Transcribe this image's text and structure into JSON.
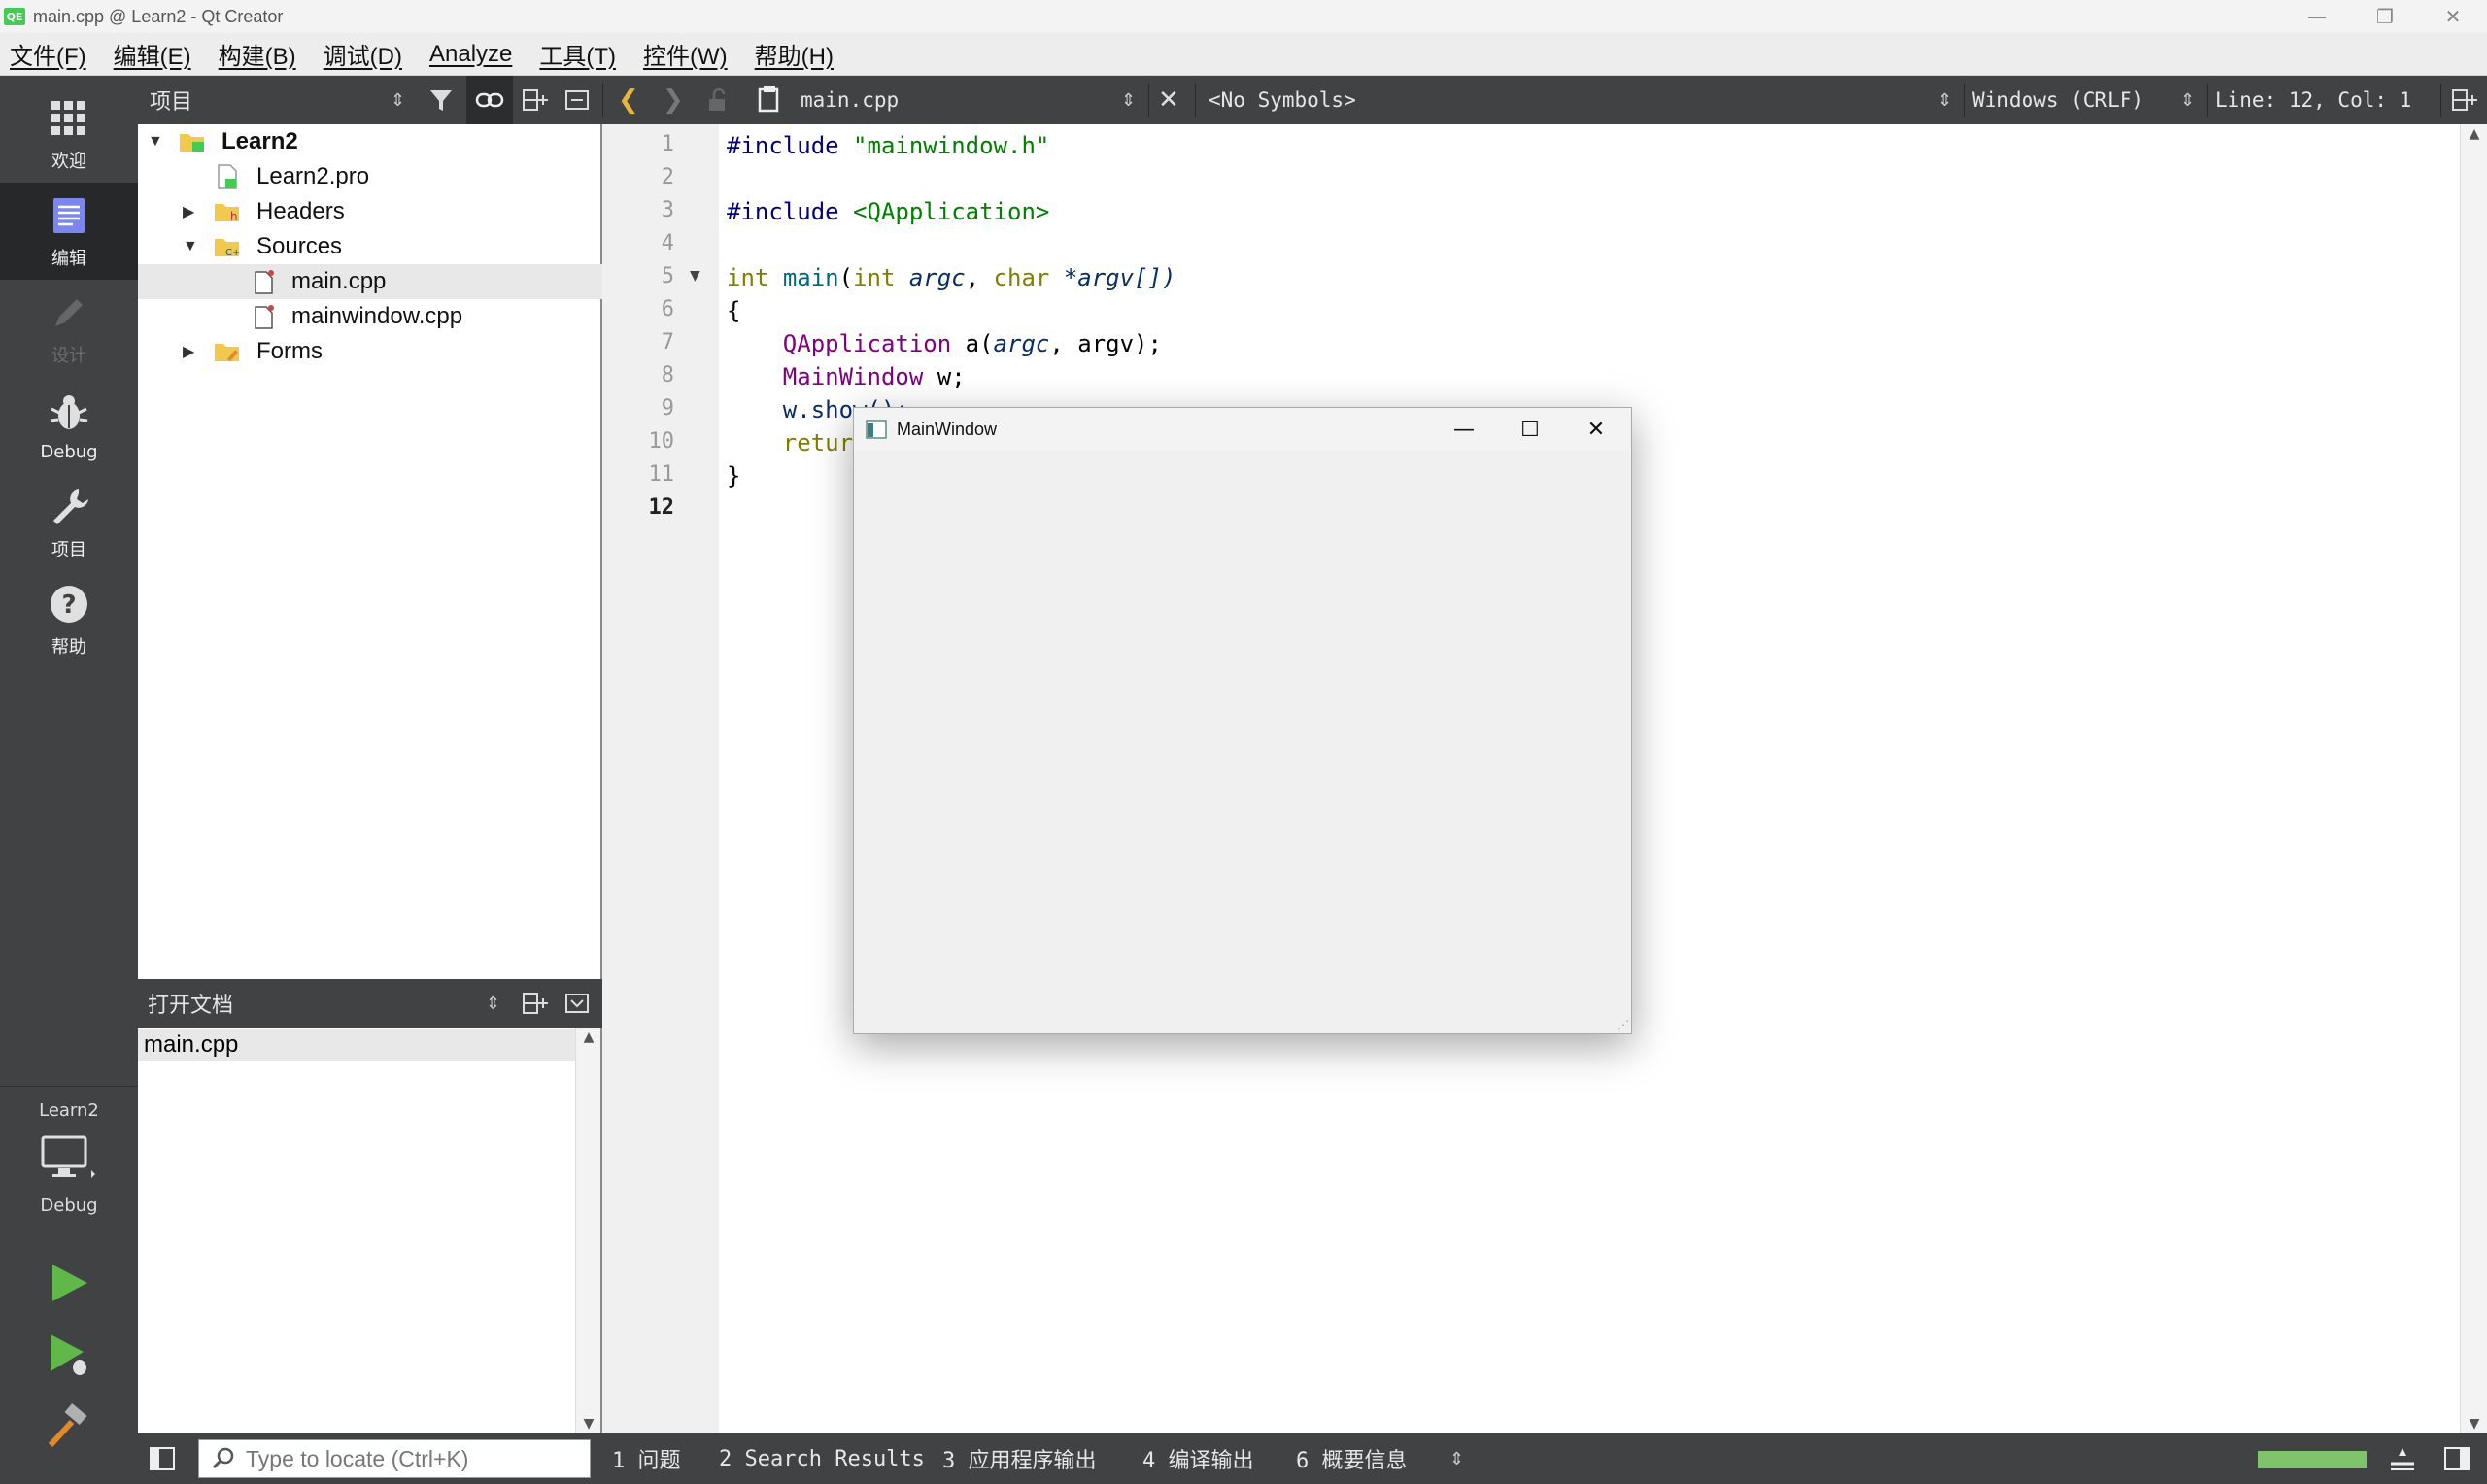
{
  "window": {
    "title": "main.cpp @ Learn2 - Qt Creator",
    "app_icon": "QE",
    "minimize": "—",
    "restore": "❐",
    "close": "✕"
  },
  "menu": [
    "文件(F)",
    "编辑(E)",
    "构建(B)",
    "调试(D)",
    "Analyze",
    "工具(T)",
    "控件(W)",
    "帮助(H)"
  ],
  "modes": {
    "welcome": "欢迎",
    "edit": "编辑",
    "design": "设计",
    "debug": "Debug",
    "projects": "项目",
    "help": "帮助"
  },
  "kit": {
    "project": "Learn2",
    "config": "Debug"
  },
  "project_panel": {
    "title": "项目",
    "tree": {
      "root": "Learn2",
      "pro": "Learn2.pro",
      "headers": "Headers",
      "sources": "Sources",
      "main_cpp": "main.cpp",
      "mainwindow_cpp": "mainwindow.cpp",
      "forms": "Forms"
    }
  },
  "open_docs": {
    "title": "打开文档",
    "items": [
      "main.cpp"
    ]
  },
  "editor_toolbar": {
    "file": "main.cpp",
    "symbols": "<No Symbols>",
    "line_ending": "Windows (CRLF)",
    "position": "Line: 12, Col: 1"
  },
  "editor": {
    "line_numbers": [
      "1",
      "2",
      "3",
      "4",
      "5",
      "6",
      "7",
      "8",
      "9",
      "10",
      "11",
      "12"
    ],
    "current_line": "12"
  },
  "code": {
    "l1_directive": "#include",
    "l1_arg": "\"mainwindow.h\"",
    "l3_directive": "#include",
    "l3_arg": "<QApplication>",
    "l5_ret": "int",
    "l5_fn": "main",
    "l5_open": "(",
    "l5_t1": "int",
    "l5_p1": "argc",
    "l5_comma": ",",
    "l5_t2": "char",
    "l5_p2": "*argv[])",
    "l6": "{",
    "l7_type": "QApplication",
    "l7_var": "a(",
    "l7_arg": "argc",
    "l7_rest": ", argv);",
    "l8_type": "MainWindow",
    "l8_var": "w;",
    "l9": "w.show();",
    "l10_kw": "return",
    "l11": "}"
  },
  "app_window": {
    "title": "MainWindow",
    "minimize": "—",
    "maximize": "☐",
    "close": "✕"
  },
  "statusbar": {
    "locator_placeholder": "Type to locate (Ctrl+K)",
    "tabs": [
      "1  问题",
      "2  Search Results",
      "3  应用程序输出",
      "4  编译输出",
      "6  概要信息"
    ]
  }
}
